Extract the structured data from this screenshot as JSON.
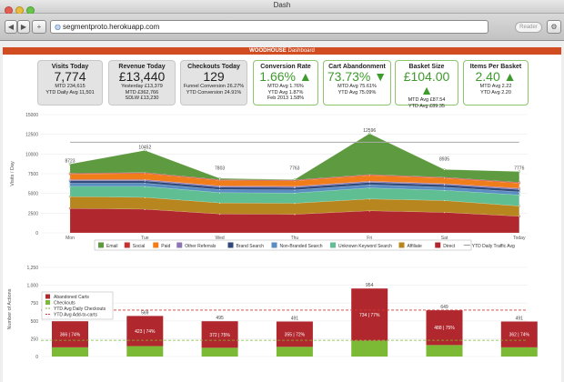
{
  "window": {
    "title": "Dash"
  },
  "toolbar": {
    "back": "◀",
    "forward": "▶",
    "new_tab": "+",
    "url": "segmentproto.herokuapp.com",
    "reader": "Reader"
  },
  "banner": {
    "brand": "WOODHOUSE",
    "title": "Dashboard"
  },
  "kpis": [
    {
      "title": "Visits Today",
      "value": "7,774",
      "lines": [
        "MTD 234,615",
        "YTD Daily Avg 11,501"
      ]
    },
    {
      "title": "Revenue Today",
      "value": "£13,440",
      "lines": [
        "Yesterday £13,379",
        "MTD £362,766",
        "SDLW £13,230"
      ]
    },
    {
      "title": "Checkouts Today",
      "value": "129",
      "lines": [
        "Funnel Conversion 26.27%",
        "YTD Conversion 24.91%"
      ]
    },
    {
      "title": "Conversion Rate",
      "value": "1.66%",
      "arrow": "▲",
      "lines": [
        "MTD Avg 1.76%",
        "YTD Avg 1.87%",
        "Feb 2013 1.58%"
      ]
    },
    {
      "title": "Cart Abandonment",
      "value": "73.73%",
      "arrow": "▼",
      "lines": [
        "MTD Avg 75.61%",
        "YTD Avg 75.09%"
      ]
    },
    {
      "title": "Basket Size",
      "value": "£104.00",
      "arrow": "▲",
      "lines": [
        "MTD Avg £87.54",
        "YTD Avg £89.35"
      ]
    },
    {
      "title": "Items Per Basket",
      "value": "2.40",
      "arrow": "▲",
      "lines": [
        "MTD Avg 2.22",
        "YTD Avg 2.20"
      ]
    }
  ],
  "chart_data": [
    {
      "type": "area",
      "ylabel": "Visits / Day",
      "ylim": [
        0,
        15000
      ],
      "yticks": [
        "0",
        "2500",
        "5000",
        "7500",
        "10000",
        "12500",
        "15000"
      ],
      "categories": [
        "Mon",
        "Tue",
        "Wed",
        "Thu",
        "Fri",
        "Sat",
        "Today"
      ],
      "stacked": true,
      "series": [
        {
          "name": "Direct",
          "color": "#b0272d",
          "values": [
            3100,
            3000,
            2400,
            2350,
            2800,
            2600,
            2100
          ]
        },
        {
          "name": "Affiliate",
          "color": "#b8861f",
          "values": [
            1500,
            1500,
            1400,
            1400,
            1500,
            1500,
            1300
          ]
        },
        {
          "name": "Unknown Keyword Search",
          "color": "#5fbf92",
          "values": [
            1300,
            1400,
            1300,
            1300,
            1400,
            1300,
            1400
          ]
        },
        {
          "name": "Non-Branded Search",
          "color": "#5a8ec2",
          "values": [
            400,
            400,
            400,
            400,
            400,
            400,
            400
          ]
        },
        {
          "name": "Brand Search",
          "color": "#2f4a7a",
          "values": [
            300,
            300,
            300,
            300,
            300,
            300,
            300
          ]
        },
        {
          "name": "Other Referrals",
          "color": "#8b75b5",
          "values": [
            150,
            150,
            150,
            150,
            150,
            150,
            150
          ]
        },
        {
          "name": "Paid",
          "color": "#f07c1a",
          "values": [
            700,
            800,
            700,
            700,
            750,
            700,
            650
          ]
        },
        {
          "name": "Social",
          "color": "#c82f2f",
          "values": [
            100,
            100,
            100,
            100,
            100,
            100,
            100
          ]
        },
        {
          "name": "Email",
          "color": "#5e9a3f",
          "values": [
            1173,
            2802,
            153,
            63,
            5196,
            985,
            1376
          ]
        }
      ],
      "totals": [
        8723,
        10452,
        7803,
        7763,
        12596,
        8935,
        7776
      ],
      "total_labels": [
        "8723",
        "10452",
        "7803",
        "7763",
        "12596",
        "8935",
        "7776"
      ],
      "ytd_daily_avg": 11501,
      "legend": [
        {
          "name": "Email",
          "color": "#5e9a3f"
        },
        {
          "name": "Social",
          "color": "#c82f2f"
        },
        {
          "name": "Paid",
          "color": "#f07c1a"
        },
        {
          "name": "Other Referrals",
          "color": "#8b75b5"
        },
        {
          "name": "Brand Search",
          "color": "#2f4a7a"
        },
        {
          "name": "Non-Branded Search",
          "color": "#5a8ec2"
        },
        {
          "name": "Unknown Keyword Search",
          "color": "#5fbf92"
        },
        {
          "name": "Affiliate",
          "color": "#b8861f"
        },
        {
          "name": "Direct",
          "color": "#b0272d"
        },
        {
          "name": "YTD Daily Traffic Avg",
          "color": "#999999",
          "line": true
        }
      ],
      "legend_position": "bottom"
    },
    {
      "type": "bar",
      "ylabel": "Number of Actions",
      "ylim": [
        0,
        1250
      ],
      "yticks": [
        "0",
        "250",
        "500",
        "750",
        "1,000",
        "1,250"
      ],
      "stacked": true,
      "series": [
        {
          "name": "Abandoned Carts",
          "color": "#b0272d",
          "values": [
            366,
            423,
            372,
            355,
            734,
            488,
            362
          ],
          "labels": [
            "366 | 74%",
            "423 | 74%",
            "372 | 75%",
            "355 | 72%",
            "734 | 77%",
            "488 | 75%",
            "362 | 74%"
          ]
        },
        {
          "name": "Checkouts",
          "color": "#7cba35",
          "values": [
            129,
            146,
            123,
            136,
            220,
            161,
            129
          ]
        }
      ],
      "totals": [
        495,
        569,
        495,
        491,
        954,
        649,
        491
      ],
      "total_labels": [
        "495",
        "569",
        "495",
        "491",
        "954",
        "649",
        "491"
      ],
      "ytd_avg_checkouts": 228,
      "ytd_avg_add_to_carts": 651,
      "legend": [
        {
          "name": "Abandoned Carts",
          "color": "#b0272d"
        },
        {
          "name": "Checkouts",
          "color": "#7cba35"
        },
        {
          "name": "YTD Avg Daily Checkouts",
          "color": "#7cba35",
          "line": true
        },
        {
          "name": "YTD Avg Add-to-carts",
          "color": "#d23a3a",
          "line": true
        }
      ],
      "legend_position": "top-left"
    }
  ]
}
